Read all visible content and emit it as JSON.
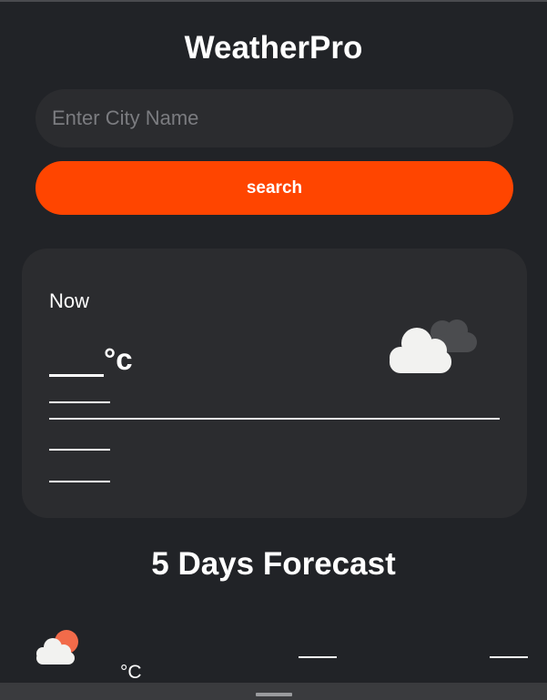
{
  "app": {
    "title": "WeatherPro"
  },
  "search": {
    "placeholder": "Enter City Name",
    "value": "",
    "button_label": "search"
  },
  "current": {
    "label": "Now",
    "temperature": "",
    "unit": "°c",
    "icon": "cloudy-icon"
  },
  "forecast": {
    "title": "5 Days Forecast",
    "unit": "°C",
    "icon": "partly-cloudy-sun-icon"
  },
  "colors": {
    "accent": "#ff4500",
    "background": "#212327",
    "card": "#2b2c2f"
  }
}
